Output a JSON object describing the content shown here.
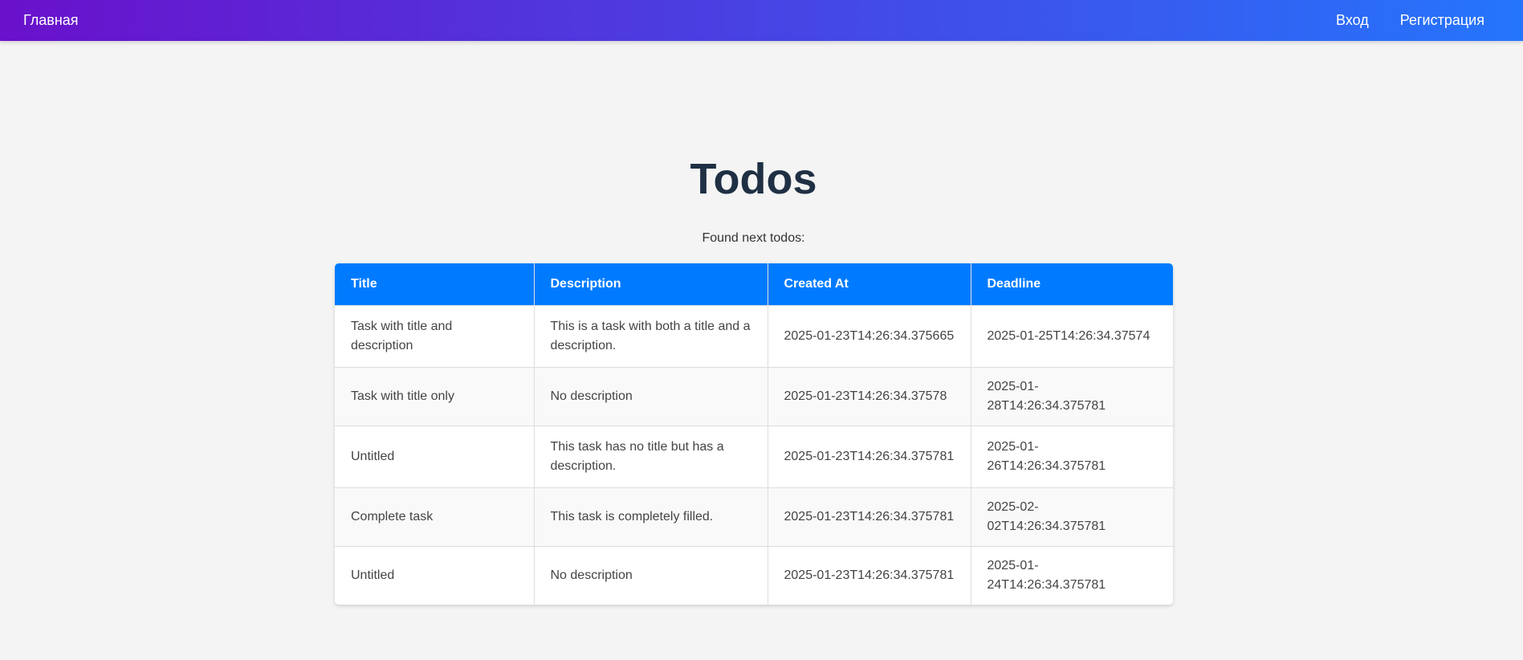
{
  "nav": {
    "home": "Главная",
    "login": "Вход",
    "register": "Регистрация"
  },
  "page": {
    "title": "Todos",
    "subtitle": "Found next todos:"
  },
  "table": {
    "headers": {
      "title": "Title",
      "description": "Description",
      "created_at": "Created At",
      "deadline": "Deadline"
    },
    "rows": [
      {
        "title": "Task with title and description",
        "description": "This is a task with both a title and a description.",
        "created_at": "2025-01-23T14:26:34.375665",
        "deadline": "2025-01-25T14:26:34.37574"
      },
      {
        "title": "Task with title only",
        "description": "No description",
        "created_at": "2025-01-23T14:26:34.37578",
        "deadline": "2025-01-28T14:26:34.375781"
      },
      {
        "title": "Untitled",
        "description": "This task has no title but has a description.",
        "created_at": "2025-01-23T14:26:34.375781",
        "deadline": "2025-01-26T14:26:34.375781"
      },
      {
        "title": "Complete task",
        "description": "This task is completely filled.",
        "created_at": "2025-01-23T14:26:34.375781",
        "deadline": "2025-02-02T14:26:34.375781"
      },
      {
        "title": "Untitled",
        "description": "No description",
        "created_at": "2025-01-23T14:26:34.375781",
        "deadline": "2025-01-24T14:26:34.375781"
      }
    ]
  },
  "colors": {
    "nav_gradient_start": "#6a11cb",
    "nav_gradient_end": "#2575fc",
    "header_bg": "#007bff",
    "title_color": "#1f3044",
    "page_bg": "#f4f4f4"
  }
}
